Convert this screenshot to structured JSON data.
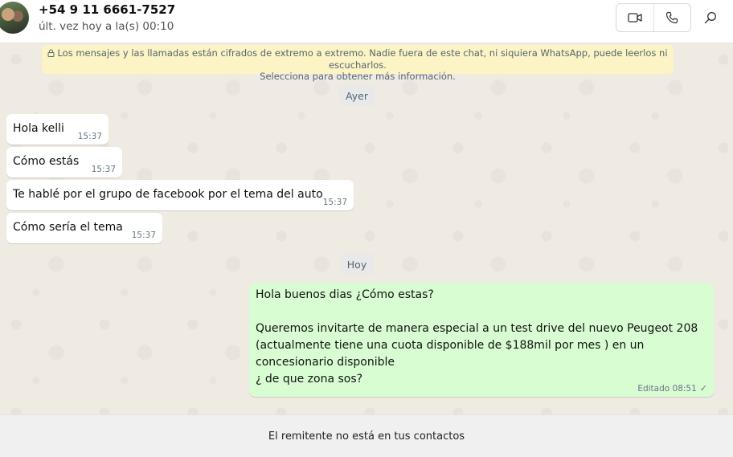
{
  "header": {
    "contact_name": "+54 9 11 6661-7527",
    "last_seen": "últ. vez hoy a la(s) 00:10"
  },
  "encryption_notice": {
    "line1": "Los mensajes y las llamadas están cifrados de extremo a extremo. Nadie fuera de este chat, ni siquiera WhatsApp, puede leerlos ni escucharlos.",
    "line2": "Selecciona para obtener más información."
  },
  "days": {
    "yesterday": "Ayer",
    "today": "Hoy"
  },
  "messages": [
    {
      "text": "Hola kelli",
      "time": "15:37"
    },
    {
      "text": "Cómo estás",
      "time": "15:37"
    },
    {
      "text": "Te hablé por el grupo de facebook por el tema del auto",
      "time": "15:37"
    },
    {
      "text": "Cómo sería el tema",
      "time": "15:37"
    },
    {
      "text": "Hola buenos dias ¿Cómo estas?\n\nQueremos invitarte de manera especial a un test drive del nuevo Peugeot 208 (actualmente tiene una cuota disponible de $188mil por mes ) en un concesionario disponible\n¿ de que zona sos?",
      "time": "Editado 08:51"
    }
  ],
  "footer": {
    "notice": "El remitente no está en tus contactos"
  },
  "colors": {
    "incoming_bubble": "#ffffff",
    "outgoing_bubble": "#d9fdd3",
    "chat_background": "#efeae2",
    "encryption_banner": "#fdf4c5"
  },
  "icons": [
    "video-call-icon",
    "voice-call-icon",
    "search-icon",
    "lock-icon",
    "read-check-icon"
  ]
}
